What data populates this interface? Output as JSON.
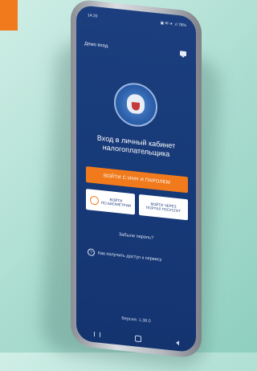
{
  "status": {
    "time": "14:20",
    "icons": "▣ ✉ ✈ .ıl 78%"
  },
  "header": {
    "demo_login": "Демо вход"
  },
  "title": [
    "Вход в личный кабинет",
    "налогоплательщика"
  ],
  "buttons": {
    "inn_password": "ВОЙТИ С ИНН И ПАРОЛЕМ",
    "biometrics": [
      "ВОЙТИ",
      "ПО БИОМЕТРИИ"
    ],
    "gosuslugi": [
      "ВОЙТИ ЧЕРЕЗ",
      "ПОРТАЛ ГОСУСЛУГ"
    ]
  },
  "links": {
    "forgot_password": "Забыли пароль?",
    "how_to_get_access": "Как получить доступ к сервису"
  },
  "footer": {
    "version": "Версия: 1.38.0"
  },
  "colors": {
    "accent": "#f07a1c",
    "screen_bg": "#1c3e7e"
  }
}
